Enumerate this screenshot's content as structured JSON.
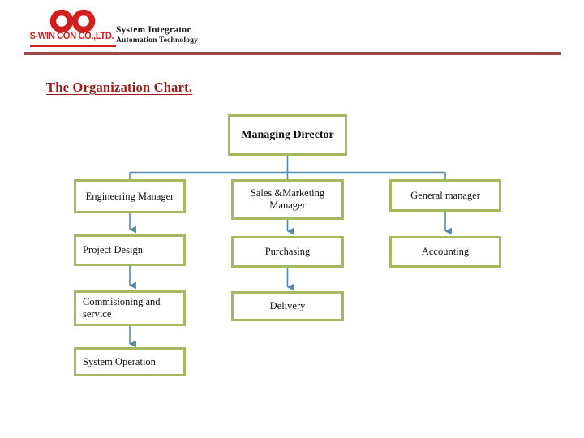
{
  "header": {
    "logo_icon": "infinity-logo-icon",
    "company_name": "S-WIN CON CO.,LTD.",
    "tagline_line1": "System Integrator",
    "tagline_line2": "Automation Technology",
    "rule_color": "#9E4A44",
    "logo_color": "#D02020"
  },
  "title": {
    "text": "The Organization Chart.",
    "color": "#9E1B18"
  },
  "chart_data": {
    "type": "diagram",
    "title": "The Organization Chart.",
    "diagram_kind": "organization-chart",
    "node_border_color": "#A7B95E",
    "connector_color": "#5B87A8",
    "nodes": [
      {
        "id": "managing_director",
        "label": "Managing Director",
        "level": 0,
        "column": "center",
        "align": "center"
      },
      {
        "id": "engineering_manager",
        "label": "Engineering Manager",
        "level": 1,
        "column": "left",
        "align": "center"
      },
      {
        "id": "sales_marketing",
        "label": "Sales &Marketing Manager",
        "level": 1,
        "column": "center",
        "align": "center"
      },
      {
        "id": "general_manager",
        "label": "General manager",
        "level": 1,
        "column": "right",
        "align": "center"
      },
      {
        "id": "project_design",
        "label": "Project Design",
        "level": 2,
        "column": "left",
        "align": "left"
      },
      {
        "id": "purchasing",
        "label": "Purchasing",
        "level": 2,
        "column": "center",
        "align": "center"
      },
      {
        "id": "accounting",
        "label": "Accounting",
        "level": 2,
        "column": "right",
        "align": "center"
      },
      {
        "id": "commisioning",
        "label": "Commisioning  and service",
        "level": 3,
        "column": "left",
        "align": "left"
      },
      {
        "id": "delivery",
        "label": "Delivery",
        "level": 3,
        "column": "center",
        "align": "center"
      },
      {
        "id": "system_operation",
        "label": "System Operation",
        "level": 4,
        "column": "left",
        "align": "left"
      }
    ],
    "edges": [
      {
        "from": "managing_director",
        "to": "engineering_manager"
      },
      {
        "from": "managing_director",
        "to": "sales_marketing"
      },
      {
        "from": "managing_director",
        "to": "general_manager"
      },
      {
        "from": "engineering_manager",
        "to": "project_design"
      },
      {
        "from": "sales_marketing",
        "to": "purchasing"
      },
      {
        "from": "general_manager",
        "to": "accounting"
      },
      {
        "from": "project_design",
        "to": "commisioning"
      },
      {
        "from": "purchasing",
        "to": "delivery"
      },
      {
        "from": "commisioning",
        "to": "system_operation"
      }
    ]
  }
}
